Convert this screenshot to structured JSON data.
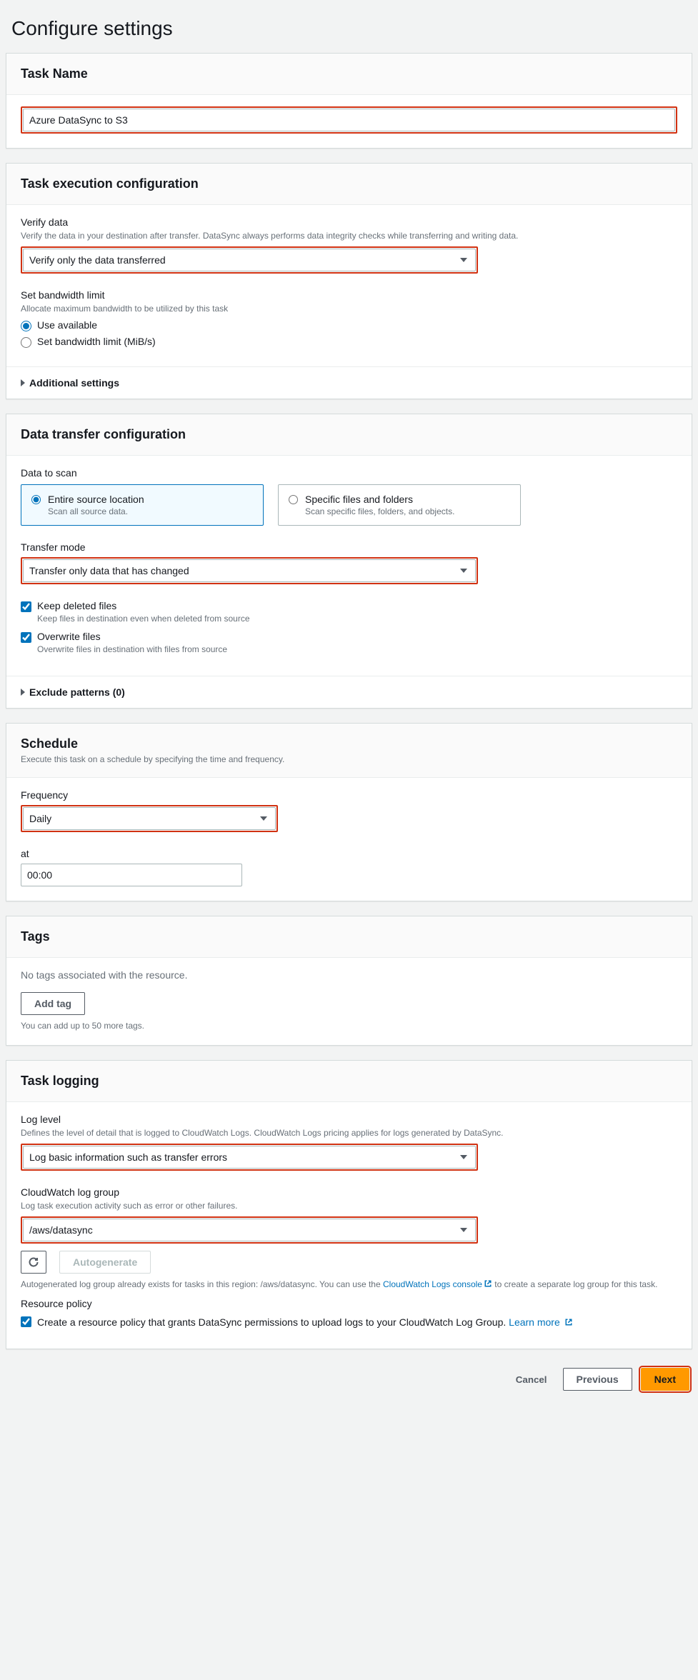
{
  "pageTitle": "Configure settings",
  "taskName": {
    "header": "Task Name",
    "value": "Azure DataSync to S3"
  },
  "execConfig": {
    "header": "Task execution configuration",
    "verify": {
      "label": "Verify data",
      "hint": "Verify the data in your destination after transfer. DataSync always performs data integrity checks while transferring and writing data.",
      "value": "Verify only the data transferred"
    },
    "bandwidth": {
      "label": "Set bandwidth limit",
      "hint": "Allocate maximum bandwidth to be utilized by this task",
      "opt1": "Use available",
      "opt2": "Set bandwidth limit (MiB/s)"
    },
    "additional": "Additional settings"
  },
  "transferConfig": {
    "header": "Data transfer configuration",
    "scan": {
      "label": "Data to scan",
      "tile1": {
        "title": "Entire source location",
        "sub": "Scan all source data."
      },
      "tile2": {
        "title": "Specific files and folders",
        "sub": "Scan specific files, folders, and objects."
      }
    },
    "mode": {
      "label": "Transfer mode",
      "value": "Transfer only data that has changed"
    },
    "keepDeleted": {
      "label": "Keep deleted files",
      "sub": "Keep files in destination even when deleted from source"
    },
    "overwrite": {
      "label": "Overwrite files",
      "sub": "Overwrite files in destination with files from source"
    },
    "exclude": "Exclude patterns (0)"
  },
  "schedule": {
    "header": "Schedule",
    "sub": "Execute this task on a schedule by specifying the time and frequency.",
    "freqLabel": "Frequency",
    "freqValue": "Daily",
    "atLabel": "at",
    "atValue": "00:00"
  },
  "tags": {
    "header": "Tags",
    "empty": "No tags associated with the resource.",
    "addBtn": "Add tag",
    "limit": "You can add up to 50 more tags."
  },
  "logging": {
    "header": "Task logging",
    "levelLabel": "Log level",
    "levelHint": "Defines the level of detail that is logged to CloudWatch Logs. CloudWatch Logs pricing applies for logs generated by DataSync.",
    "levelValue": "Log basic information such as transfer errors",
    "groupLabel": "CloudWatch log group",
    "groupHint": "Log task execution activity such as error or other failures.",
    "groupValue": "/aws/datasync",
    "autogenBtn": "Autogenerate",
    "autogenNote1": "Autogenerated log group already exists for tasks in this region: /aws/datasync. You can use the ",
    "autogenLink": "CloudWatch Logs console",
    "autogenNote2": " to create a separate log group for this task.",
    "policyLabel": "Resource policy",
    "policyCheck": "Create a resource policy that grants DataSync permissions to upload logs to your CloudWatch Log Group. ",
    "learnMore": "Learn more"
  },
  "footer": {
    "cancel": "Cancel",
    "previous": "Previous",
    "next": "Next"
  }
}
